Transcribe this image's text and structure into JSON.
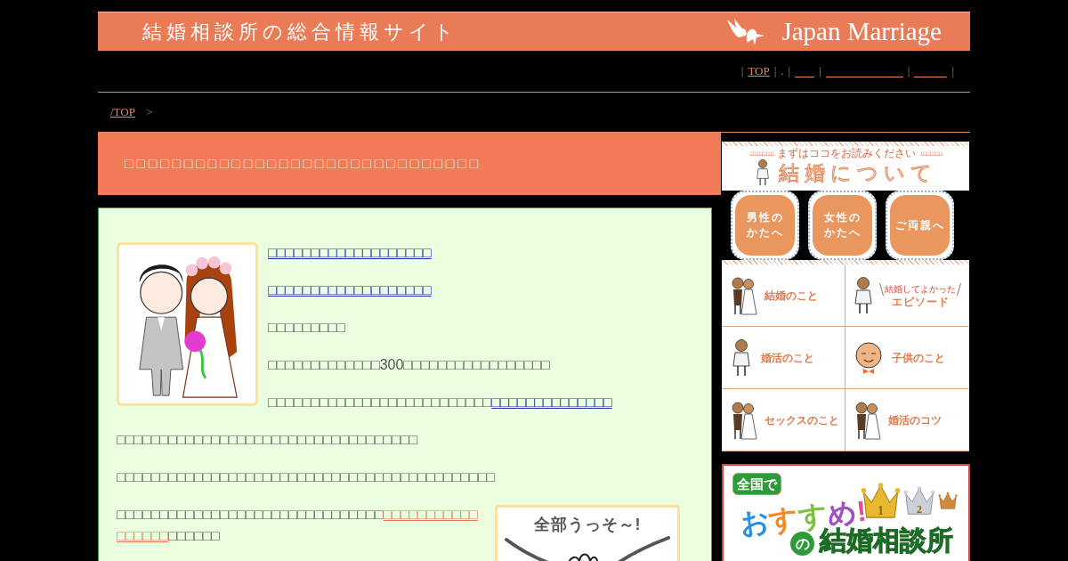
{
  "header": {
    "title": "結婚相談所の総合情報サイト",
    "logo": "Japan Marriage"
  },
  "nav": [
    {
      "kind": "separator",
      "text": "|"
    },
    {
      "kind": "link",
      "text": "TOP"
    },
    {
      "kind": "separator",
      "text": "|"
    },
    {
      "kind": "text",
      "text": "."
    },
    {
      "kind": "separator",
      "text": "|"
    },
    {
      "kind": "blank"
    },
    {
      "kind": "separator",
      "text": "|"
    },
    {
      "kind": "blank"
    },
    {
      "kind": "separator",
      "text": "|"
    },
    {
      "kind": "blank"
    },
    {
      "kind": "separator",
      "text": "|"
    }
  ],
  "breadcrumb": [
    {
      "kind": "link",
      "text": "/TOP"
    },
    {
      "kind": "separator",
      "text": ">"
    }
  ],
  "article": {
    "title": "□□□□□□□□□□□□□□□□□□□□□□□□□□□□□□",
    "beside_image": [
      {
        "parts": [
          {
            "kind": "link",
            "text": "□□□□□□□□□□□□□□□□□□□"
          }
        ]
      },
      {
        "parts": [
          {
            "kind": "link",
            "text": "□□□□□□□□□□□□□□□□□□□"
          }
        ]
      },
      {
        "parts": [
          {
            "kind": "plain",
            "text": "□□□□□□□□□"
          }
        ]
      },
      {
        "parts": [
          {
            "kind": "plain",
            "text": "□□□□□□□□□□□□□300□□□□□□□□□□□□□□□□□"
          }
        ]
      },
      {
        "parts": [
          {
            "kind": "plain",
            "text": "□□□□□□□□□□□□□□□□□□□□□□□□□□"
          },
          {
            "kind": "link",
            "text": "□□□□□□□□□□□□□□"
          }
        ]
      }
    ],
    "body": [
      {
        "parts": [
          {
            "kind": "plain",
            "text": "□□□□□□□□□□□□□□□□□□□□□□□□□□□□□□□□□□□"
          }
        ]
      },
      {
        "parts": [
          {
            "kind": "plain",
            "text": "□□□□□□□□□□□□□□□□□□□□□□□□□□□□□□□□□□□□□□□□□□□□"
          }
        ]
      }
    ],
    "closing": {
      "parts": [
        {
          "kind": "plain",
          "text": "□□□□□□□□□□□□□□□□□□□□□□□□□□□□□□□"
        },
        {
          "kind": "highlight_link",
          "text": "□□□□□□□□□□□"
        },
        {
          "kind": "highlight_link",
          "text": "□□□□□□"
        },
        {
          "kind": "plain",
          "text": "□□□□□□"
        }
      ],
      "image_caption": "全部うっそ～!"
    }
  },
  "sidebar": {
    "intro": {
      "arrows_left": "↓↓↓↓↓↓↓↓↓↓↓",
      "note": "まずはココをお読みください",
      "arrows_right": "↓↓↓↓↓↓↓↓↓↓",
      "title": "結婚について"
    },
    "audience_buttons": [
      {
        "label": "男性のかたへ"
      },
      {
        "label": "女性のかたへ"
      },
      {
        "label": "ご両親へ"
      }
    ],
    "topics": [
      {
        "label": "結婚のこと",
        "kind": "pair"
      },
      {
        "label": "エピソード",
        "caption": "結婚してよかった",
        "kind": "single"
      },
      {
        "label": "婚活のこと",
        "kind": "single"
      },
      {
        "label": "子供のこと",
        "kind": "face"
      },
      {
        "label": "セックスのこと",
        "kind": "pair"
      },
      {
        "label": "婚活のコツ",
        "kind": "pair"
      }
    ],
    "banner": {
      "badge": "全国で",
      "headline": "おすすめ!",
      "crowns": [
        {
          "kind": "gold",
          "label": "1"
        },
        {
          "kind": "silver",
          "label": "2"
        },
        {
          "kind": "bronze"
        }
      ],
      "particle": "の",
      "title": "結婚相談所"
    }
  }
}
